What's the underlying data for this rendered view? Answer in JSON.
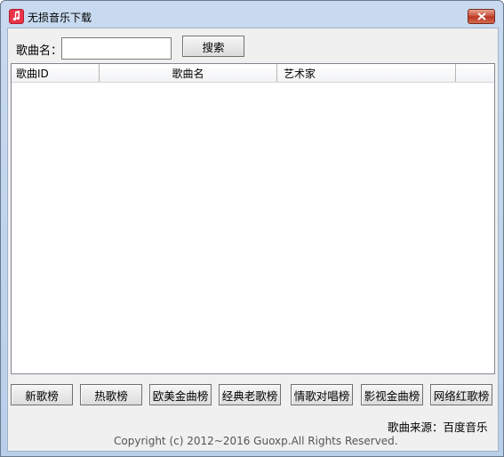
{
  "window": {
    "title": "无损音乐下载",
    "icon": "music-note-icon"
  },
  "search": {
    "label": "歌曲名：",
    "value": "",
    "placeholder": "",
    "button_label": "搜索"
  },
  "table": {
    "columns": [
      "歌曲ID",
      "歌曲名",
      "艺术家",
      ""
    ],
    "rows": []
  },
  "charts": [
    "新歌榜",
    "热歌榜",
    "欧美金曲榜",
    "经典老歌榜",
    "情歌对唱榜",
    "影视金曲榜",
    "网络红歌榜"
  ],
  "footer": {
    "source": "歌曲来源：百度音乐",
    "copyright": "Copyright (c)  2012~2016 Guoxp.All Rights Reserved."
  },
  "colors": {
    "icon_red": "#e8344a",
    "close_red": "#c64a32",
    "titlebar": "#c8daef"
  }
}
